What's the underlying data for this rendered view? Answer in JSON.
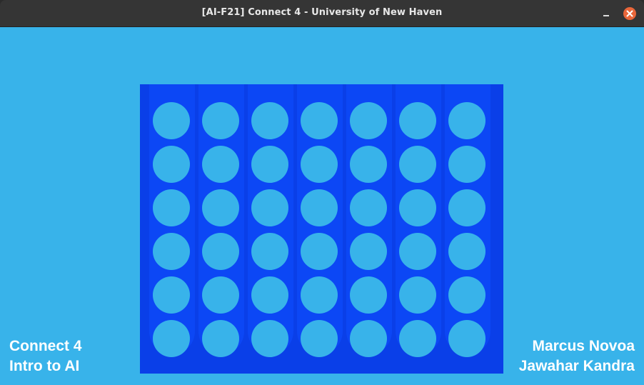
{
  "window": {
    "title": "[AI-F21] Connect 4 - University of New Haven"
  },
  "colors": {
    "background": "#38b3ea",
    "board": "#0a3fe8",
    "board_column": "#0c47f5",
    "hole": "#38b3ea"
  },
  "board": {
    "columns": 7,
    "rows": 6,
    "cells": [
      [
        "empty",
        "empty",
        "empty",
        "empty",
        "empty",
        "empty",
        "empty"
      ],
      [
        "empty",
        "empty",
        "empty",
        "empty",
        "empty",
        "empty",
        "empty"
      ],
      [
        "empty",
        "empty",
        "empty",
        "empty",
        "empty",
        "empty",
        "empty"
      ],
      [
        "empty",
        "empty",
        "empty",
        "empty",
        "empty",
        "empty",
        "empty"
      ],
      [
        "empty",
        "empty",
        "empty",
        "empty",
        "empty",
        "empty",
        "empty"
      ],
      [
        "empty",
        "empty",
        "empty",
        "empty",
        "empty",
        "empty",
        "empty"
      ]
    ]
  },
  "footer_left": {
    "line1": "Connect 4",
    "line2": "Intro to AI"
  },
  "footer_right": {
    "line1": "Marcus Novoa",
    "line2": "Jawahar Kandra"
  },
  "icons": {
    "minimize": "minimize-icon",
    "close": "close-icon"
  }
}
